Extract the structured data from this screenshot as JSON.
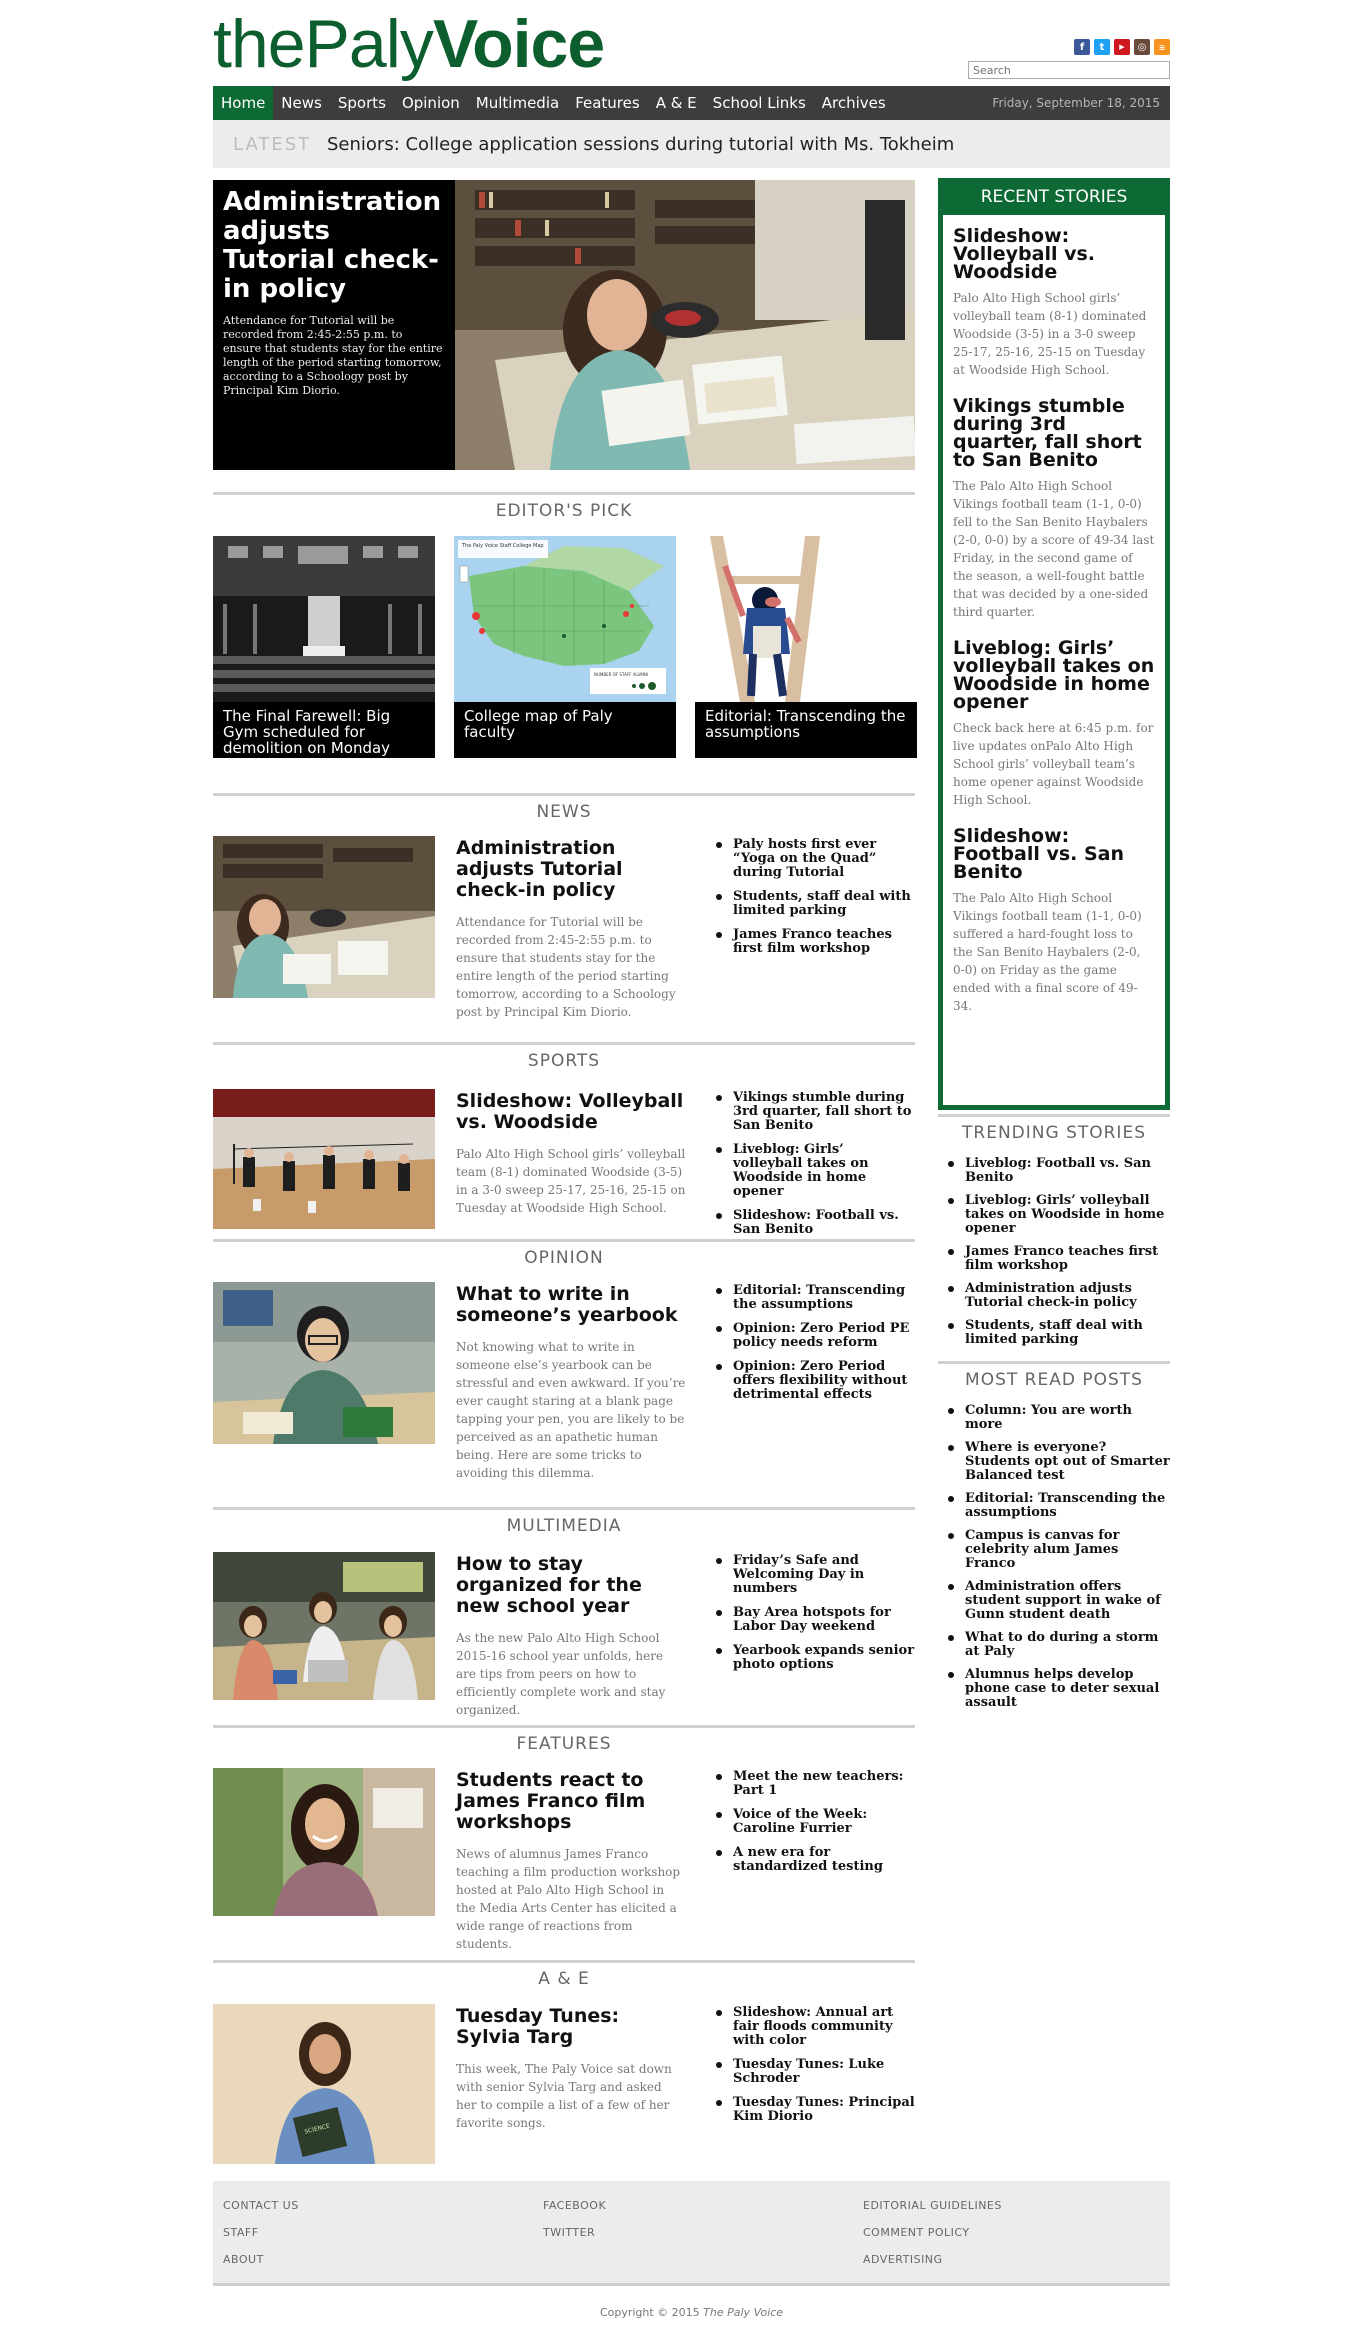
{
  "header": {
    "logo_the": "the",
    "logo_paly": "Paly",
    "logo_voice": "Voice",
    "search_placeholder": "Search",
    "social_icons": [
      "facebook-icon",
      "twitter-icon",
      "youtube-icon",
      "instagram-icon",
      "rss-icon"
    ]
  },
  "nav": {
    "items": [
      "Home",
      "News",
      "Sports",
      "Opinion",
      "Multimedia",
      "Features",
      "A & E",
      "School Links",
      "Archives"
    ],
    "date": "Friday, September 18, 2015"
  },
  "latest": {
    "label": "LATEST",
    "text": "Seniors: College application sessions during tutorial with Ms. Tokheim"
  },
  "hero": {
    "title": "Administration adjusts Tutorial check-in policy",
    "desc": "Attendance for Tutorial will be recorded from 2:45-2:55 p.m. to ensure that students stay for the entire length of the period starting tomorrow, according to a Schoology post by Principal Kim Diorio."
  },
  "editors_pick": {
    "heading": "EDITOR'S PICK",
    "items": [
      {
        "caption": "The Final Farewell: Big Gym scheduled for demolition on Monday"
      },
      {
        "caption": "College map of Paly faculty",
        "map_title": "The Paly Voice Staff College Map",
        "map_legend": "NUMBER OF STAFF ALUMNI"
      },
      {
        "caption": "Editorial: Transcending the assumptions"
      }
    ]
  },
  "sections": [
    {
      "heading": "NEWS",
      "title": "Administration adjusts Tutorial check-in policy",
      "desc": "Attendance for Tutorial will be recorded from 2:45-2:55 p.m. to ensure that students stay for the entire length of the period starting tomorrow, according to a Schoology post by Principal Kim Diorio.",
      "links": [
        "Paly hosts first ever “Yoga on the Quad” during Tutorial",
        "Students, staff deal with limited parking",
        "James Franco teaches first film workshop"
      ]
    },
    {
      "heading": "SPORTS",
      "title": "Slideshow: Volleyball vs. Woodside",
      "desc": "Palo Alto High School girls’ volleyball team (8-1) dominated Woodside (3-5) in a 3-0 sweep 25-17, 25-16, 25-15 on Tuesday at Woodside High School.",
      "links": [
        "Vikings stumble during 3rd quarter, fall short to San Benito",
        "Liveblog: Girls’ volleyball takes on Woodside in home opener",
        "Slideshow: Football vs. San Benito"
      ]
    },
    {
      "heading": "OPINION",
      "title": "What to write in someone’s yearbook",
      "desc": "Not knowing what to write in someone else’s yearbook can be stressful and even awkward. If you’re ever caught staring at a blank page tapping your pen, you are likely to be perceived as an apathetic human being. Here are some tricks to avoiding this dilemma.",
      "links": [
        "Editorial: Transcending the assumptions",
        "Opinion: Zero Period PE policy needs reform",
        "Opinion: Zero Period offers flexibility without detrimental effects"
      ]
    },
    {
      "heading": "MULTIMEDIA",
      "title": "How to stay organized for the new school year",
      "desc": "As the new Palo Alto High School 2015-16 school year unfolds, here are tips from peers on how to efficiently complete work and stay organized.",
      "links": [
        "Friday’s Safe and Welcoming Day in numbers",
        "Bay Area hotspots for Labor Day weekend",
        "Yearbook expands senior photo options"
      ]
    },
    {
      "heading": "FEATURES",
      "title": "Students react to James Franco film workshops",
      "desc": "News of alumnus James Franco teaching a film production workshop hosted at Palo Alto High School in the Media Arts Center has elicited a wide range of reactions from students.",
      "links": [
        "Meet the new teachers: Part 1",
        "Voice of the Week: Caroline Furrier",
        "A new era for standardized testing"
      ]
    },
    {
      "heading": "A & E",
      "title": "Tuesday Tunes: Sylvia Targ",
      "desc": "This week, The Paly Voice sat down with senior Sylvia Targ and asked her to compile a list of a few of her favorite songs.",
      "links": [
        "Slideshow: Annual art fair floods community with color",
        "Tuesday Tunes: Luke Schroder",
        "Tuesday Tunes: Principal Kim Diorio"
      ]
    }
  ],
  "recent": {
    "heading": "RECENT STORIES",
    "items": [
      {
        "title": "Slideshow: Volleyball vs. Woodside",
        "desc": "Palo Alto High School girls’ volleyball team (8-1) dominated Woodside (3-5) in a 3-0 sweep 25-17, 25-16, 25-15 on Tuesday at Woodside High School."
      },
      {
        "title": "Vikings stumble during 3rd quarter, fall short to San Benito",
        "desc": "The Palo Alto High School Vikings football team (1-1, 0-0) fell to the San Benito Haybalers (2-0, 0-0) by a score of 49-34 last Friday, in the second game of the season, a well-fought battle that was decided by a one-sided third quarter."
      },
      {
        "title": "Liveblog: Girls’ volleyball takes on Woodside in home opener",
        "desc": "Check back here at 6:45 p.m. for live updates onPalo Alto High School girls’ volleyball team’s home opener against Woodside High School."
      },
      {
        "title": "Slideshow: Football vs. San Benito",
        "desc": "The Palo Alto High School Vikings football team (1-1, 0-0) suffered a hard-fought loss to the San Benito Haybalers (2-0, 0-0) on Friday as the game ended with a final score of 49-34."
      }
    ]
  },
  "trending": {
    "heading": "TRENDING STORIES",
    "items": [
      "Liveblog: Football vs. San Benito",
      "Liveblog: Girls’ volleyball takes on Woodside in home opener",
      "James Franco teaches first film workshop",
      "Administration adjusts Tutorial check-in policy",
      "Students, staff deal with limited parking"
    ]
  },
  "most_read": {
    "heading": "MOST READ POSTS",
    "items": [
      "Column: You are worth more",
      "Where is everyone? Students opt out of Smarter Balanced test",
      "Editorial: Transcending the assumptions",
      "Campus is canvas for celebrity alum James Franco",
      "Administration offers student support in wake of Gunn student death",
      "What to do during a storm at Paly",
      "Alumnus helps develop phone case to deter sexual assault"
    ]
  },
  "footer": {
    "col1": [
      "CONTACT US",
      "STAFF",
      "ABOUT"
    ],
    "col2": [
      "FACEBOOK",
      "TWITTER"
    ],
    "col3": [
      "EDITORIAL GUIDELINES",
      "COMMENT POLICY",
      "ADVERTISING"
    ],
    "copyright_prefix": "Copyright © 2015 ",
    "copyright_name": "The Paly Voice"
  },
  "colors": {
    "brand_green": "#0d6a35",
    "nav_bg": "#3d3d3d",
    "latest_bg": "#ececec"
  }
}
